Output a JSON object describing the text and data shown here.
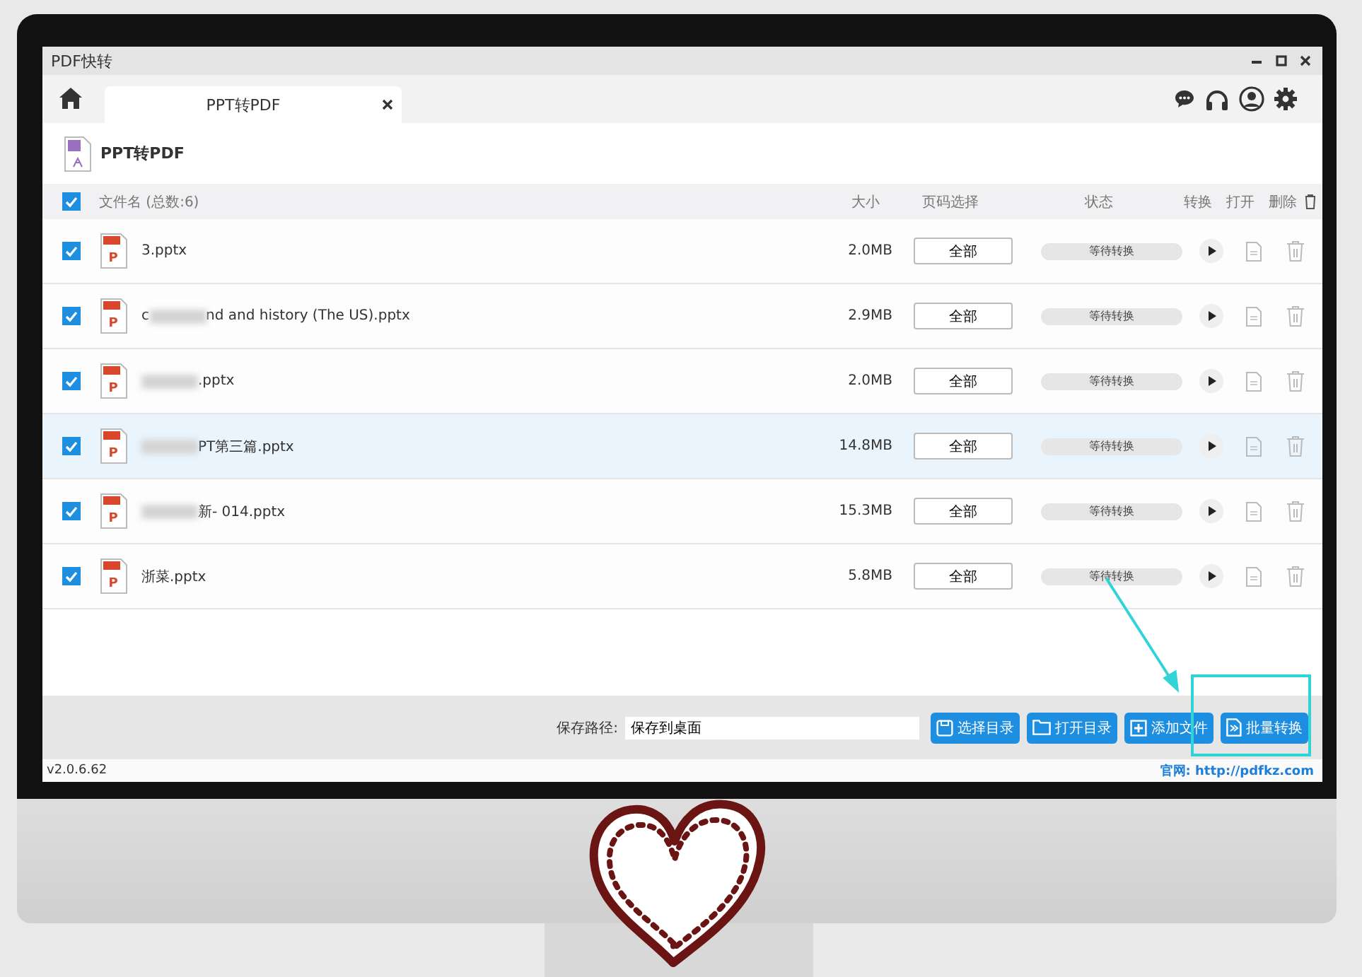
{
  "window": {
    "title": "PDF快转"
  },
  "tabs": [
    {
      "label": "PPT转PDF",
      "selected": true
    }
  ],
  "page": {
    "title": "PPT转PDF"
  },
  "table": {
    "all_checked": true,
    "columns": [
      "文件名 (总数:6)",
      "大小",
      "页码选择",
      "状态",
      "转换",
      "打开",
      "删除"
    ],
    "rows": [
      {
        "checked": true,
        "selected": false,
        "name_start": "",
        "blurred": false,
        "name": "3.pptx",
        "icon_letter": "P",
        "size": "2.0MB",
        "pages": "全部",
        "status": "等待转换"
      },
      {
        "checked": true,
        "selected": false,
        "name_start": "c",
        "blurred": true,
        "name": "nd and history (The US).pptx",
        "icon_letter": "P",
        "size": "2.9MB",
        "pages": "全部",
        "status": "等待转换"
      },
      {
        "checked": true,
        "selected": false,
        "name_start": "",
        "blurred": true,
        "name": ".pptx",
        "icon_letter": "P",
        "size": "2.0MB",
        "pages": "全部",
        "status": "等待转换"
      },
      {
        "checked": true,
        "selected": true,
        "name_start": "",
        "blurred": true,
        "name": "PT第三篇.pptx",
        "icon_letter": "P",
        "size": "14.8MB",
        "pages": "全部",
        "status": "等待转换"
      },
      {
        "checked": true,
        "selected": false,
        "name_start": "",
        "blurred": true,
        "name": "新- 014.pptx",
        "icon_letter": "P",
        "size": "15.3MB",
        "pages": "全部",
        "status": "等待转换"
      },
      {
        "checked": true,
        "selected": false,
        "name_start": "",
        "blurred": false,
        "name": "浙菜.pptx",
        "icon_letter": "P",
        "size": "5.8MB",
        "pages": "全部",
        "status": "等待转换"
      }
    ]
  },
  "bottom_bar": {
    "save_label": "保存路径:",
    "save_path": "保存到桌面",
    "buttons": [
      {
        "kind": "save",
        "label": "选择目录"
      },
      {
        "kind": "folder",
        "label": "打开目录"
      },
      {
        "kind": "add",
        "label": "添加文件"
      },
      {
        "kind": "convert",
        "label": "批量转换"
      }
    ]
  },
  "status_bar": {
    "version": "v2.0.6.62",
    "website": "官网: http://pdfkz.com"
  }
}
